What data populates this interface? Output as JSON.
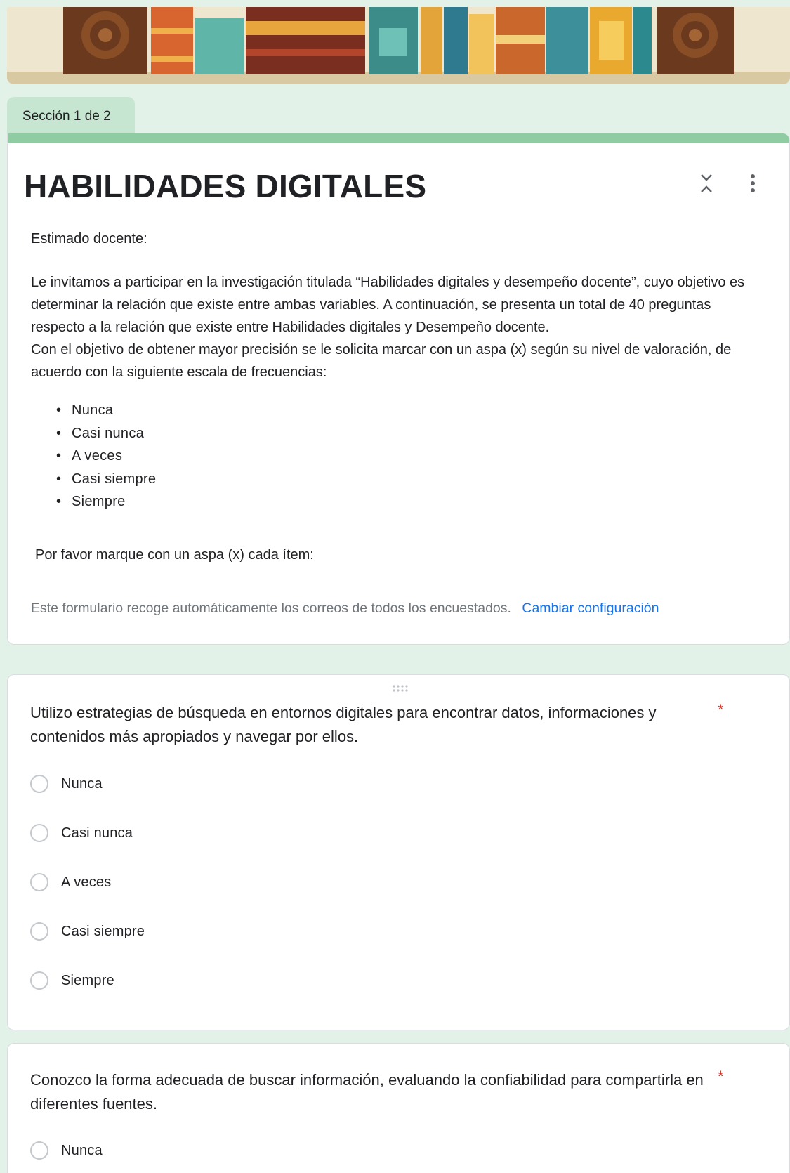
{
  "section": {
    "label": "Sección 1 de 2"
  },
  "form": {
    "title": "HABILIDADES DIGITALES",
    "greeting": "Estimado docente:",
    "intro": "Le invitamos a participar en la investigación titulada “Habilidades digitales y desempeño docente”, cuyo objetivo es determinar la relación que existe entre ambas variables. A continuación, se presenta un total de 40 preguntas respecto a la relación que existe entre Habilidades digitales y Desempeño docente.",
    "intro2": "Con el objetivo de obtener mayor precisión se le solicita marcar con un aspa (x) según su nivel de valoración, de acuerdo con la siguiente escala de frecuencias:",
    "scale": [
      "Nunca",
      "Casi nunca",
      "A veces",
      "Casi siempre",
      "Siempre"
    ],
    "instruction": "Por favor marque con un aspa (x) cada ítem:",
    "email_note": "Este formulario recoge automáticamente los correos de todos los encuestados.",
    "email_link": "Cambiar configuración"
  },
  "questions": [
    {
      "text": "Utilizo estrategias de búsqueda en entornos digitales para encontrar datos, informaciones y contenidos más apropiados y navegar por ellos.",
      "required_mark": "*",
      "options": [
        "Nunca",
        "Casi nunca",
        "A veces",
        "Casi siempre",
        "Siempre"
      ]
    },
    {
      "text": "Conozco la forma adecuada de buscar información, evaluando la confiabilidad para compartirla en diferentes fuentes.",
      "required_mark": "*",
      "options": [
        "Nunca"
      ]
    }
  ],
  "icons": {
    "collapse": "collapse-section-icon",
    "more": "more-options-icon",
    "drag": "drag-handle-icon"
  },
  "colors": {
    "page_bg": "#e3f2e9",
    "accent": "#8fcca1",
    "link": "#1a73e8",
    "required": "#d93025"
  }
}
